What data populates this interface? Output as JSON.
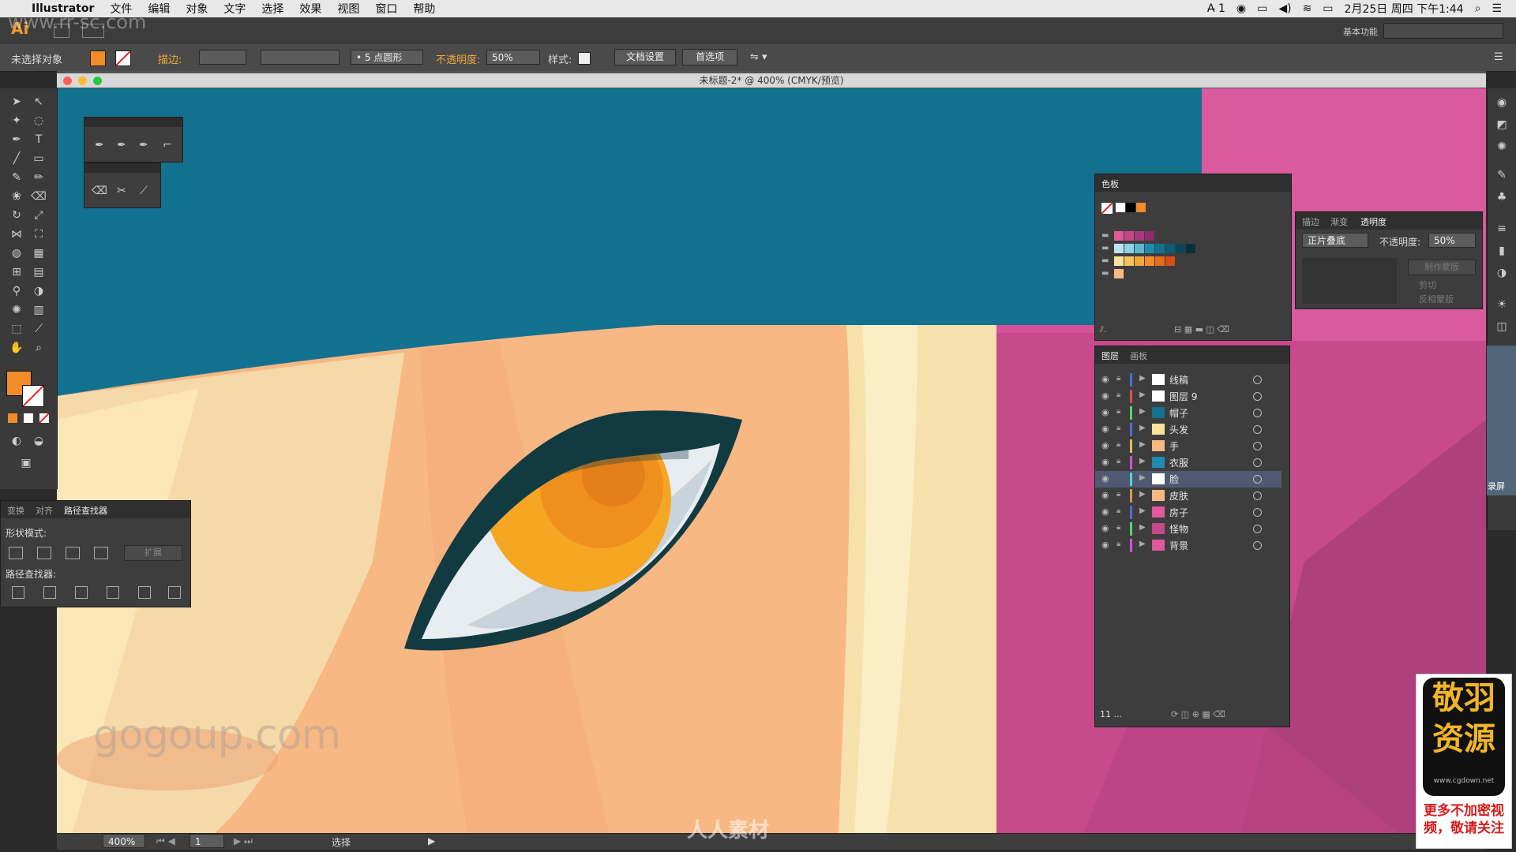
{
  "menubar": {
    "apple": "",
    "app": "Illustrator",
    "items": [
      "文件",
      "编辑",
      "对象",
      "文字",
      "选择",
      "效果",
      "视图",
      "窗口",
      "帮助"
    ],
    "datetime": "2月25日 周四 下午1:44",
    "status_icon_text": "1"
  },
  "appbar": {
    "logo": "Ai",
    "workspace": "基本功能"
  },
  "control": {
    "selection": "未选择对象",
    "fill_color": "#f28c28",
    "stroke_label": "描边:",
    "brush": "5 点圆形",
    "opacity_label": "不透明度:",
    "opacity_value": "50%",
    "style_label": "样式:",
    "doc_setup": "文档设置",
    "prefs": "首选项"
  },
  "document": {
    "title": "未标题-2* @ 400% (CMYK/预览)"
  },
  "status": {
    "zoom": "400%",
    "page": "1",
    "tool": "选择"
  },
  "pathfinder": {
    "tabs": [
      "变换",
      "对齐",
      "路径查找器"
    ],
    "shape_modes": "形状模式:",
    "expand": "扩展",
    "pathfinders": "路径查找器:"
  },
  "swatches": {
    "title": "色板",
    "rows": [
      [
        "#ffffff",
        "#000000",
        "#f28c28"
      ],
      [
        "#e15a9b",
        "#c54889",
        "#a63a7c",
        "#8d2d6b"
      ],
      [
        "#bde4ee",
        "#8fd1e3",
        "#5ab9d1",
        "#1f8bb0",
        "#137190",
        "#0f5a73",
        "#0c4559",
        "#0a2f3b"
      ],
      [
        "#f9e29a",
        "#f5c45a",
        "#f2a93a",
        "#f28c28",
        "#e56b1d",
        "#d44e17"
      ],
      [
        "#f8b883"
      ]
    ]
  },
  "transparency": {
    "tabs": [
      "描边",
      "渐变",
      "透明度"
    ],
    "blend_mode": "正片叠底",
    "opacity_label": "不透明度:",
    "opacity_value": "50%",
    "make_mask": "制作蒙版",
    "clip": "剪切",
    "invert": "反相蒙版"
  },
  "layers": {
    "tabs": [
      "图层",
      "画板"
    ],
    "footer": "11 ...",
    "rows": [
      {
        "name": "线稿",
        "color": "#4f6bd8",
        "thumb": "#ffffff"
      },
      {
        "name": "图层 9",
        "color": "#d84f4f",
        "thumb": "#ffffff"
      },
      {
        "name": "帽子",
        "color": "#4fd86b",
        "thumb": "#137190"
      },
      {
        "name": "头发",
        "color": "#4f6bd8",
        "thumb": "#f9e29a"
      },
      {
        "name": "手",
        "color": "#d8c24f",
        "thumb": "#f8b883"
      },
      {
        "name": "衣服",
        "color": "#d84fd8",
        "thumb": "#1f8bb0"
      },
      {
        "name": "脸",
        "color": "#4fd8d8",
        "thumb": "#ffffff"
      },
      {
        "name": "皮肤",
        "color": "#d8954f",
        "thumb": "#f8b883"
      },
      {
        "name": "房子",
        "color": "#4f6bd8",
        "thumb": "#e15a9b"
      },
      {
        "name": "怪物",
        "color": "#4fd86b",
        "thumb": "#c54889"
      },
      {
        "name": "背景",
        "color": "#d84fd8",
        "thumb": "#e15a9b"
      }
    ]
  },
  "watermarks": {
    "site": "www.rr-sc.com",
    "gogoup": "gogoup.com",
    "center": "人人素材",
    "badge_title": "敬羽资源",
    "badge_url": "www.cgdown.net",
    "badge_note": "更多不加密视频，敬请关注",
    "recorder": "录屏"
  }
}
